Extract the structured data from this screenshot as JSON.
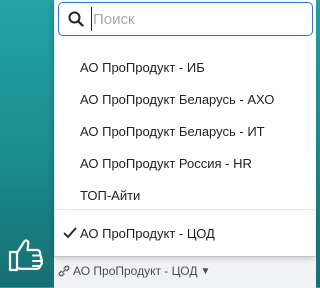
{
  "search": {
    "placeholder": "Поиск",
    "value": ""
  },
  "dropdown": {
    "options": [
      {
        "label": "АО ПроПродукт - ИБ"
      },
      {
        "label": "АО ПроПродукт Беларусь - АХО"
      },
      {
        "label": "АО ПроПродукт Беларусь - ИТ"
      },
      {
        "label": "АО ПроПродукт Россия - HR"
      },
      {
        "label": "ТОП-Айти"
      }
    ],
    "selected": {
      "label": "АО ПроПродукт - ЦОД",
      "icon": "checkmark-icon"
    }
  },
  "org_selector": {
    "label": "АО ПроПродукт - ЦОД",
    "icon": "link-icon",
    "caret": "▼"
  },
  "colors": {
    "background_teal": "#1f9a9d",
    "focus_border": "#3a6fe0",
    "text": "#222222"
  }
}
